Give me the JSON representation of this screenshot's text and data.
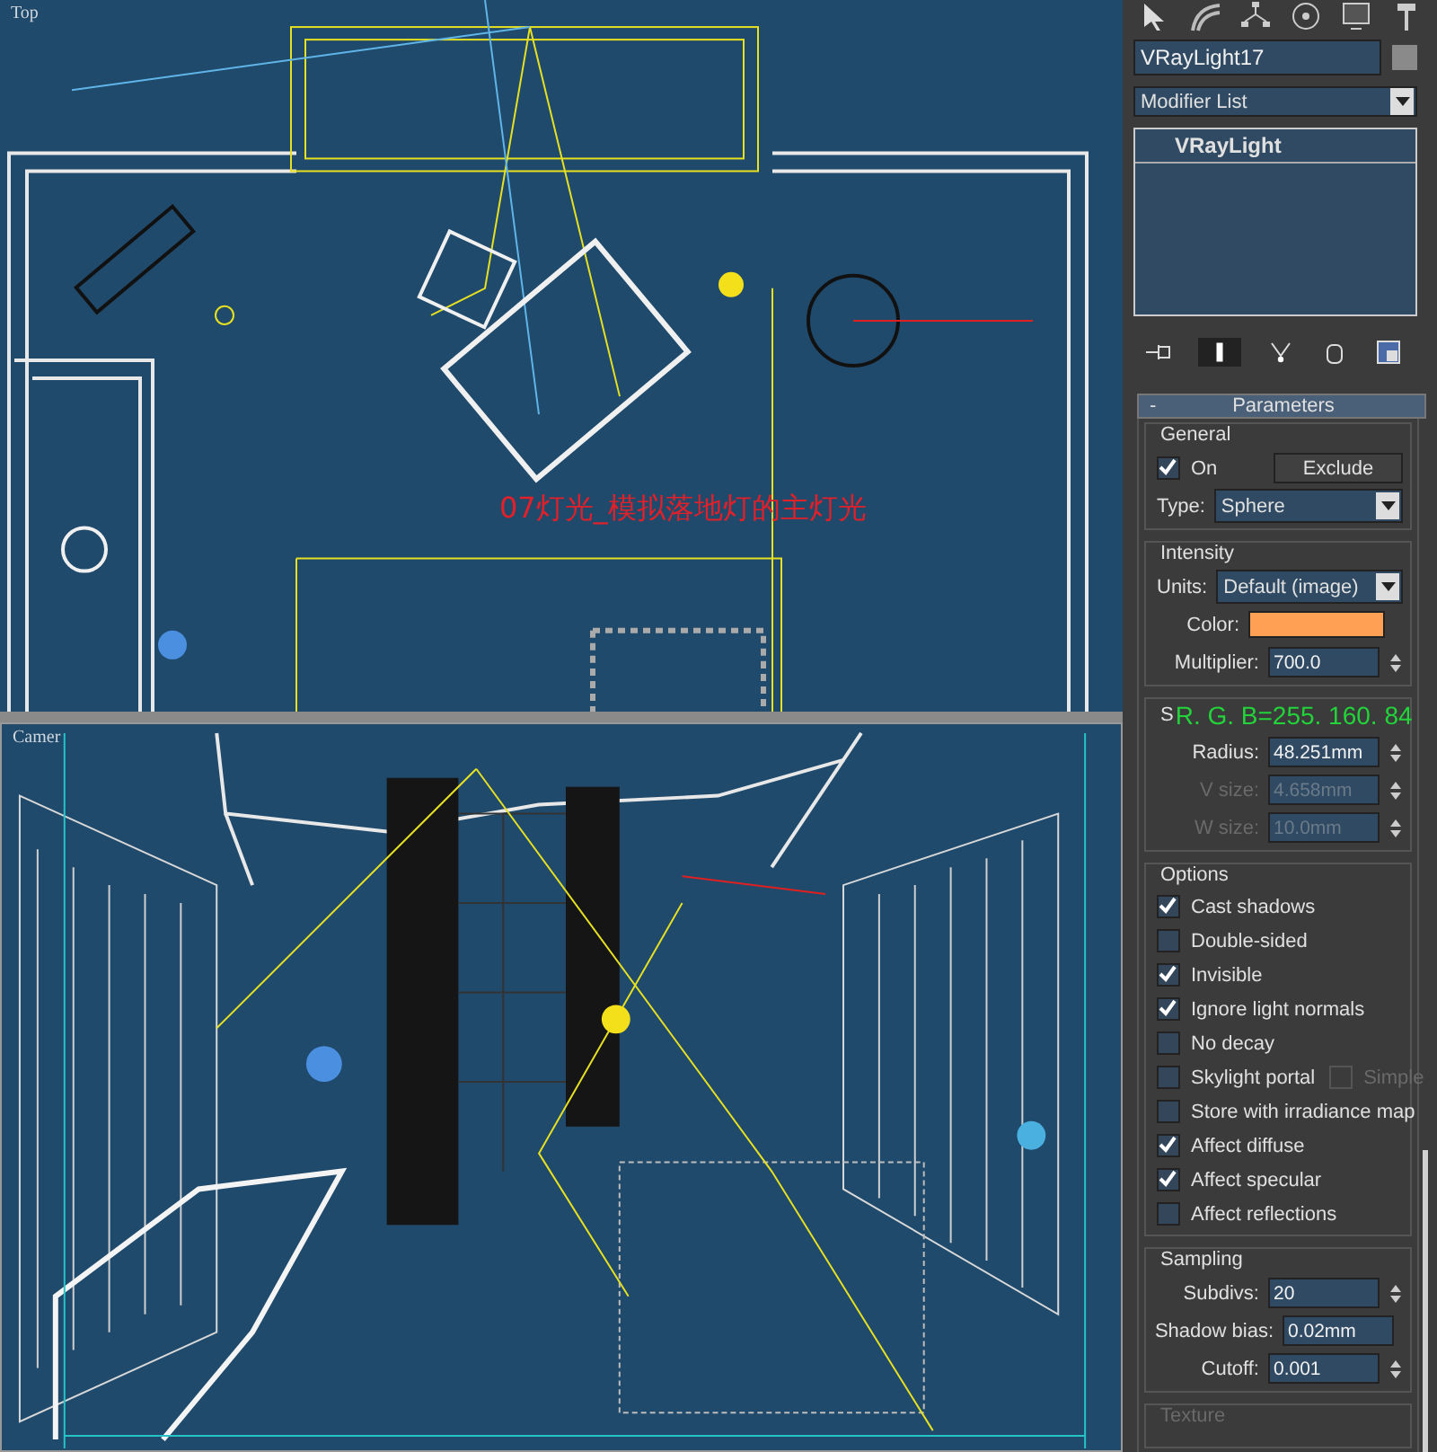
{
  "viewports": [
    {
      "kind": "top",
      "label": "Top",
      "annotation": "07灯光_模拟落地灯的主灯光"
    },
    {
      "kind": "camera",
      "label": "Camer"
    }
  ],
  "command_panel": {
    "object_name": "VRayLight17",
    "modifier_list": "Modifier List",
    "modifier_stack": [
      {
        "label": "VRayLight",
        "selected": false
      }
    ],
    "rollout": {
      "toggle": "-",
      "title": "Parameters"
    },
    "general": {
      "title": "General",
      "on": {
        "label": "On",
        "checked": true
      },
      "exclude": "Exclude",
      "type_label": "Type:",
      "type_value": "Sphere"
    },
    "intensity": {
      "title": "Intensity",
      "units_label": "Units:",
      "units_value": "Default (image)",
      "color_label": "Color:",
      "color": "#ffa054",
      "multiplier_label": "Multiplier:",
      "multiplier": "700.0"
    },
    "size": {
      "title": "S",
      "fields": [
        {
          "label": "Radius:",
          "value": "48.251mm",
          "disabled": false
        },
        {
          "label": "V size:",
          "value": "4.658mm",
          "disabled": true
        },
        {
          "label": "W size:",
          "value": "10.0mm",
          "disabled": true
        }
      ]
    },
    "rgb_note": "R. G. B=255. 160. 84",
    "options": {
      "title": "Options",
      "items": [
        {
          "label": "Cast shadows",
          "checked": true
        },
        {
          "label": "Double-sided",
          "checked": false
        },
        {
          "label": "Invisible",
          "checked": true
        },
        {
          "label": "Ignore light normals",
          "checked": true
        },
        {
          "label": "No decay",
          "checked": false
        },
        {
          "label": "Skylight portal",
          "checked": false,
          "extra": {
            "label": "Simple",
            "checked": false,
            "disabled": true
          }
        },
        {
          "label": "Store with irradiance map",
          "checked": false
        },
        {
          "label": "Affect diffuse",
          "checked": true
        },
        {
          "label": "Affect specular",
          "checked": true
        },
        {
          "label": "Affect reflections",
          "checked": false
        }
      ]
    },
    "sampling": {
      "title": "Sampling",
      "fields": [
        {
          "label": "Subdivs:",
          "value": "20"
        },
        {
          "label": "Shadow bias:",
          "value": "0.02mm"
        },
        {
          "label": "Cutoff:",
          "value": "0.001"
        }
      ]
    },
    "texture": {
      "title": "Texture"
    }
  }
}
